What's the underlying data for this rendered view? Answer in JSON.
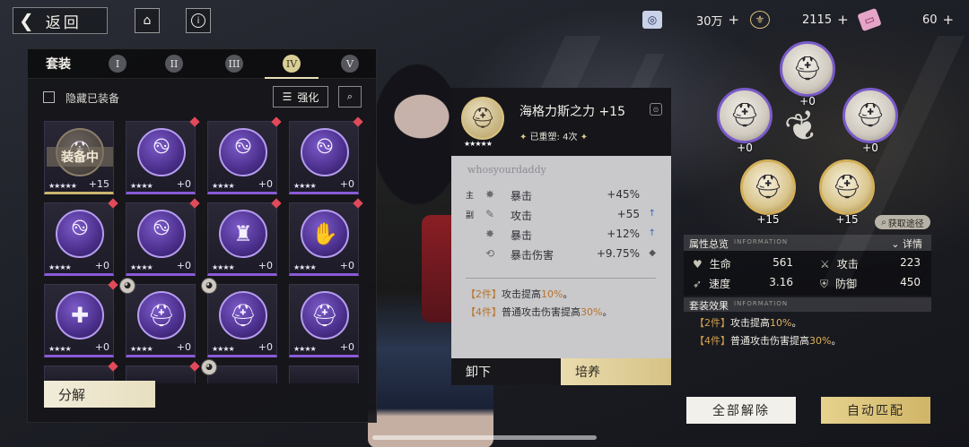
{
  "topbar": {
    "back_label": "返回",
    "currencies": [
      {
        "icon": "coin-icon",
        "value": "30万"
      },
      {
        "icon": "fleur-icon",
        "value": "2115"
      },
      {
        "icon": "ticket-icon",
        "value": "60"
      }
    ],
    "plus": "+"
  },
  "left_panel": {
    "title": "套装",
    "tabs": [
      "I",
      "II",
      "III",
      "IV",
      "V"
    ],
    "active_tab": "IV",
    "hide_equipped_label": "隐藏已装备",
    "enhance_label": "强化",
    "equipped_tag": "装备中",
    "decompose_label": "分解",
    "items": [
      {
        "icon": "helmet-icon",
        "stars": "★★★★★",
        "level": "+15",
        "equipped": true,
        "dot": false
      },
      {
        "icon": "swirl-gear-icon",
        "stars": "★★★★",
        "level": "+0",
        "dot": true
      },
      {
        "icon": "swirl-gear-icon",
        "stars": "★★★★",
        "level": "+0",
        "dot": true
      },
      {
        "icon": "swirl-gear-icon",
        "stars": "★★★★",
        "level": "+0",
        "dot": true
      },
      {
        "icon": "swirl-gear-icon",
        "stars": "★★★★",
        "level": "+0",
        "dot": true
      },
      {
        "icon": "swirl-gear-icon",
        "stars": "★★★★",
        "level": "+0",
        "dot": true
      },
      {
        "icon": "warrior-icon",
        "stars": "★★★★",
        "level": "+0",
        "dot": true
      },
      {
        "icon": "hands-icon",
        "stars": "★★★★",
        "level": "+0",
        "dot": true
      },
      {
        "icon": "cross-sword-icon",
        "stars": "★★★★",
        "level": "+0",
        "dot": true
      },
      {
        "icon": "helmet-icon",
        "stars": "★★★★",
        "level": "+0",
        "owner": true
      },
      {
        "icon": "helmet-icon",
        "stars": "★★★★",
        "level": "+0",
        "owner": true
      },
      {
        "icon": "helmet-icon",
        "stars": "★★★★",
        "level": "+0"
      }
    ]
  },
  "detail": {
    "name": "海格力斯之力 +15",
    "stars": "★★★★★",
    "reshape_label": "已重塑:",
    "reshape_value": "4次",
    "owner": "whosyourdaddy",
    "stats": [
      {
        "tag": "主",
        "icon": "crit-icon",
        "name": "暴击",
        "value": "+45%",
        "up": ""
      },
      {
        "tag": "副",
        "icon": "feather-icon",
        "name": "攻击",
        "value": "+55",
        "up": "↑"
      },
      {
        "tag": "",
        "icon": "crit-icon",
        "name": "暴击",
        "value": "+12%",
        "up": "↑"
      },
      {
        "tag": "",
        "icon": "crit-dmg-icon",
        "name": "暴击伤害",
        "value": "+9.75%",
        "up": "◆"
      }
    ],
    "set_effects": [
      {
        "pieces": "【2件】",
        "text": "攻击提高",
        "value": "10%",
        "suffix": "。"
      },
      {
        "pieces": "【4件】",
        "text": "普通攻击伤害提高",
        "value": "30%",
        "suffix": "。"
      }
    ],
    "unequip_label": "卸下",
    "train_label": "培养"
  },
  "slots": [
    {
      "level": "+0",
      "gold": false
    },
    {
      "level": "+0",
      "gold": false
    },
    {
      "level": "+0",
      "gold": false
    },
    {
      "level": "+15",
      "gold": true
    },
    {
      "level": "+15",
      "gold": true
    }
  ],
  "get_route_label": "获取途径",
  "info": {
    "overview_title": "属性总览",
    "overview_en": "INFORMATION",
    "details_label": "详情",
    "attrs": [
      {
        "icon": "heart-icon",
        "name": "生命",
        "value": "561"
      },
      {
        "icon": "sword-icon",
        "name": "攻击",
        "value": "223"
      },
      {
        "icon": "speed-icon",
        "name": "速度",
        "value": "3.16"
      },
      {
        "icon": "shield-icon",
        "name": "防御",
        "value": "450"
      }
    ],
    "set_title": "套装效果",
    "set_en": "INFORMATION",
    "effects": [
      {
        "pieces": "【2件】",
        "text": "攻击提高",
        "value": "10%",
        "suffix": "。"
      },
      {
        "pieces": "【4件】",
        "text": "普通攻击伤害提高",
        "value": "30%",
        "suffix": "。"
      }
    ]
  },
  "bottom": {
    "unequip_all_label": "全部解除",
    "auto_match_label": "自动匹配"
  },
  "colors": {
    "rarity_purple": "#8a5ad8",
    "gold_accent": "#d4b05a",
    "highlight": "#b5742a"
  }
}
